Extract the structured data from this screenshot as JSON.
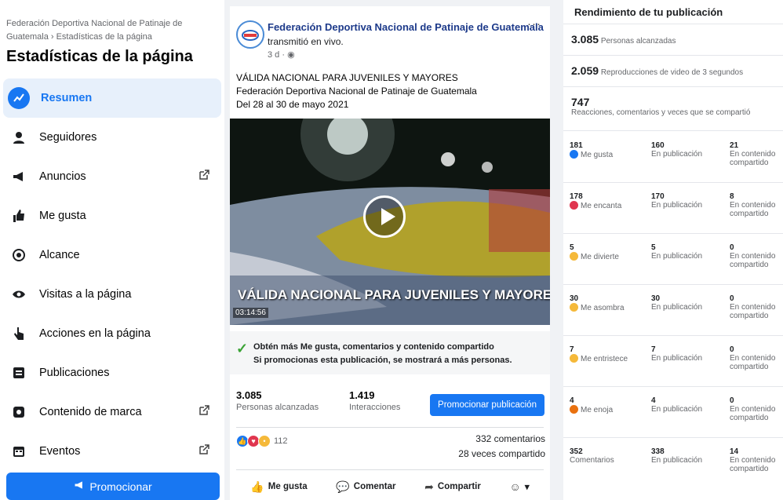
{
  "sidebar": {
    "breadcrumb": "Federación Deportiva Nacional de Patinaje de Guatemala › Estadísticas de la página",
    "title": "Estadísticas de la página",
    "items": [
      {
        "label": "Resumen",
        "icon": "summary-icon"
      },
      {
        "label": "Seguidores",
        "icon": "followers-icon"
      },
      {
        "label": "Anuncios",
        "icon": "megaphone-icon",
        "external": true
      },
      {
        "label": "Me gusta",
        "icon": "thumbs-up-icon"
      },
      {
        "label": "Alcance",
        "icon": "reach-icon"
      },
      {
        "label": "Visitas a la página",
        "icon": "eye-icon"
      },
      {
        "label": "Acciones en la página",
        "icon": "pointer-icon"
      },
      {
        "label": "Publicaciones",
        "icon": "posts-icon"
      },
      {
        "label": "Contenido de marca",
        "icon": "branded-content-icon",
        "external": true
      },
      {
        "label": "Eventos",
        "icon": "calendar-icon",
        "external": true
      }
    ],
    "promote_label": "Promocionar"
  },
  "post": {
    "page_name": "Federación Deportiva Nacional de Patinaje de Guatemala",
    "action": "transmitió en vivo.",
    "time": "3 d · ",
    "more": "···",
    "line1": "VÁLIDA NACIONAL PARA JUVENILES Y MAYORES",
    "line2": "Federación Deportiva Nacional de Patinaje de Guatemala",
    "line3": "Del 28 al 30 de mayo 2021",
    "video_title": "VÁLIDA NACIONAL PARA JUVENILES Y MAYORES",
    "video_time": "03:14:56",
    "boost_line1": "Obtén más Me gusta, comentarios y contenido compartido",
    "boost_line2": "Si promocionas esta publicación, se mostrará a más personas.",
    "reach_value": "3.085",
    "reach_label": "Personas alcanzadas",
    "interactions_value": "1.419",
    "interactions_label": "Interacciones",
    "promote_post_label": "Promocionar publicación",
    "reaction_count": "112",
    "comments": "332 comentarios",
    "shares": "28 veces compartido",
    "like_label": "Me gusta",
    "comment_label": "Comentar",
    "share_label": "Compartir"
  },
  "performance": {
    "title": "Rendimiento de tu publicación",
    "reached_value": "3.085",
    "reached_label": "Personas alcanzadas",
    "views_value": "2.059",
    "views_label": "Reproducciones de video de 3 segundos",
    "engagement_value": "747",
    "engagement_label": "Reacciones, comentarios y veces que se compartió",
    "rows": [
      {
        "total": "181",
        "label": "Me gusta",
        "color": "#1877f2",
        "post": "160",
        "post_label": "En publicación",
        "shared": "21",
        "shared_label": "En contenido compartido"
      },
      {
        "total": "178",
        "label": "Me encanta",
        "color": "#e0364f",
        "post": "170",
        "post_label": "En publicación",
        "shared": "8",
        "shared_label": "En contenido compartido"
      },
      {
        "total": "5",
        "label": "Me divierte",
        "color": "#f5b93a",
        "post": "5",
        "post_label": "En publicación",
        "shared": "0",
        "shared_label": "En contenido compartido"
      },
      {
        "total": "30",
        "label": "Me asombra",
        "color": "#f5b93a",
        "post": "30",
        "post_label": "En publicación",
        "shared": "0",
        "shared_label": "En contenido compartido"
      },
      {
        "total": "7",
        "label": "Me entristece",
        "color": "#f5b93a",
        "post": "7",
        "post_label": "En publicación",
        "shared": "0",
        "shared_label": "En contenido compartido"
      },
      {
        "total": "4",
        "label": "Me enoja",
        "color": "#e9710f",
        "post": "4",
        "post_label": "En publicación",
        "shared": "0",
        "shared_label": "En contenido compartido"
      },
      {
        "total": "352",
        "label": "Comentarios",
        "color": "",
        "post": "338",
        "post_label": "En publicación",
        "shared": "14",
        "shared_label": "En contenido compartido"
      }
    ]
  }
}
